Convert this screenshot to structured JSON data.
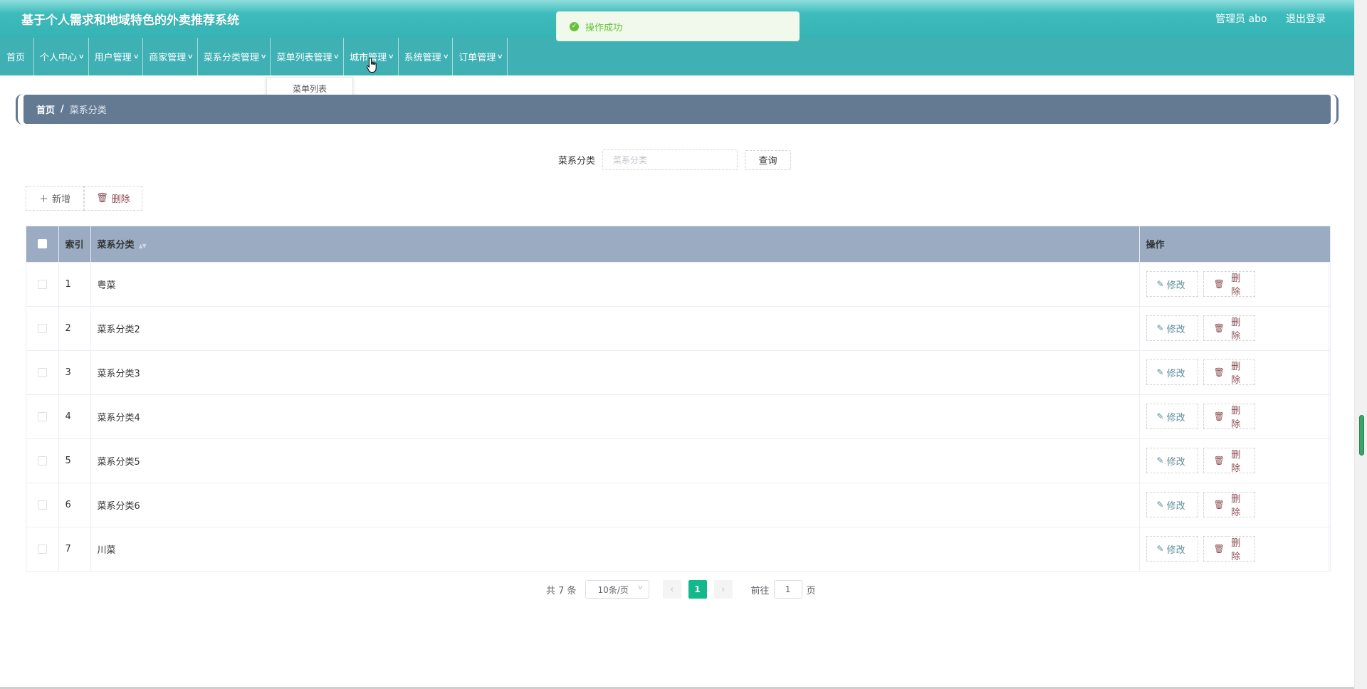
{
  "header": {
    "app_title": "基于个人需求和地域特色的外卖推荐系统",
    "user_label": "管理员 abo",
    "logout_label": "退出登录"
  },
  "toast": {
    "message": "操作成功"
  },
  "nav": {
    "items": [
      {
        "label": "首页",
        "has_dropdown": false
      },
      {
        "label": "个人中心",
        "has_dropdown": true
      },
      {
        "label": "用户管理",
        "has_dropdown": true
      },
      {
        "label": "商家管理",
        "has_dropdown": true
      },
      {
        "label": "菜系分类管理",
        "has_dropdown": true
      },
      {
        "label": "菜单列表管理",
        "has_dropdown": true
      },
      {
        "label": "城市管理",
        "has_dropdown": true
      },
      {
        "label": "系统管理",
        "has_dropdown": true
      },
      {
        "label": "订单管理",
        "has_dropdown": true
      }
    ],
    "dropdown_item": "菜单列表"
  },
  "breadcrumb": {
    "home": "首页",
    "separator": "/",
    "current": "菜系分类"
  },
  "search": {
    "label": "菜系分类",
    "placeholder": "菜系分类",
    "button": "查询"
  },
  "toolbar": {
    "add_label": "新增",
    "delete_label": "删除"
  },
  "table": {
    "headers": {
      "index": "索引",
      "category": "菜系分类",
      "actions": "操作"
    },
    "rows": [
      {
        "index": "1",
        "category": "粤菜"
      },
      {
        "index": "2",
        "category": "菜系分类2"
      },
      {
        "index": "3",
        "category": "菜系分类3"
      },
      {
        "index": "4",
        "category": "菜系分类4"
      },
      {
        "index": "5",
        "category": "菜系分类5"
      },
      {
        "index": "6",
        "category": "菜系分类6"
      },
      {
        "index": "7",
        "category": "川菜"
      }
    ],
    "edit_label": "修改",
    "delete_label": "删除"
  },
  "pagination": {
    "total_text": "共 7 条",
    "page_size": "10条/页",
    "current_page": "1",
    "goto_label": "前往",
    "goto_value": "1",
    "page_suffix": "页"
  },
  "colors": {
    "header_teal": "#3ebcbc",
    "nav_teal": "#3fb1b4",
    "breadcrumb": "#647a93",
    "table_header": "#9aabc2",
    "pager_active": "#14b88d",
    "toast_green": "#67c23a"
  },
  "icons": {
    "success": "check-circle-icon",
    "add": "plus-icon",
    "delete": "trash-icon",
    "edit": "pencil-icon",
    "chevron": "chevron-down-icon",
    "sort": "sort-caret-icon",
    "prev": "chevron-left-icon",
    "next": "chevron-right-icon"
  }
}
